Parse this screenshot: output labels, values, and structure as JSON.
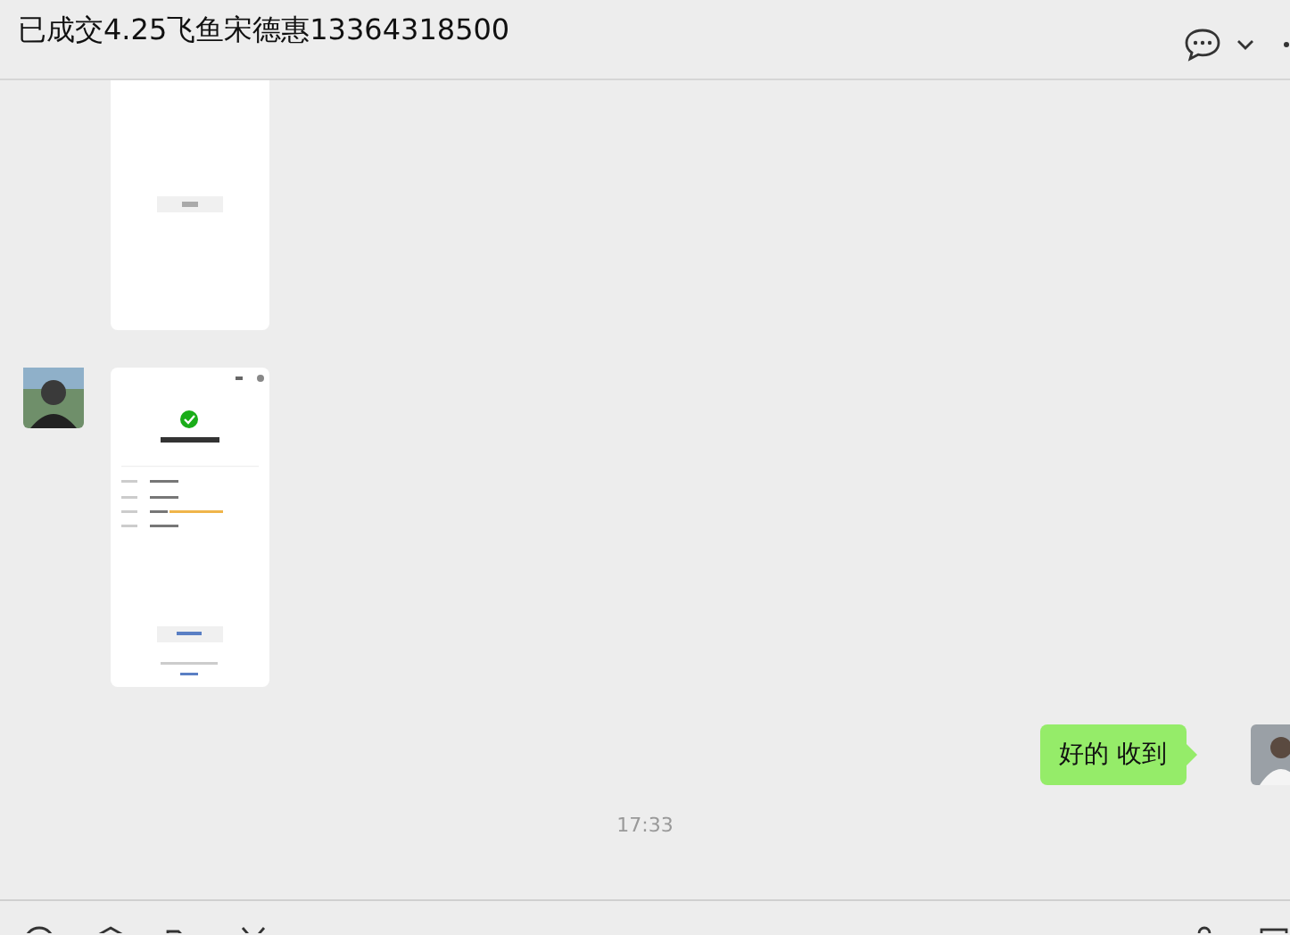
{
  "chat": {
    "title": "已成交4.25飞鱼宋德惠13364318500"
  },
  "messages": [
    {
      "kind": "receipt"
    },
    {
      "kind": "payment"
    },
    {
      "kind": "sent",
      "text": "好的 收到"
    },
    {
      "kind": "time",
      "text": "17:33"
    },
    {
      "kind": "partial"
    }
  ]
}
